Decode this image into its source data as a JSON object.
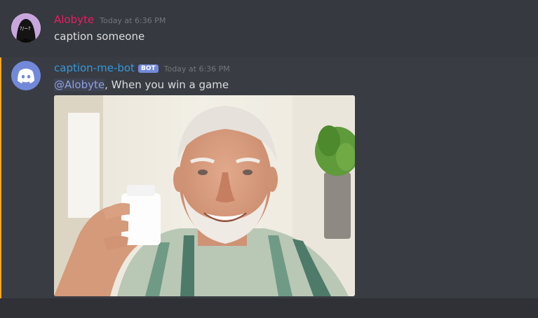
{
  "messages": [
    {
      "author": "Alobyte",
      "author_color": "#e91e63",
      "timestamp": "Today at 6:36 PM",
      "text": "caption someone",
      "avatar_icon": "dark-figure-avatar"
    },
    {
      "author": "caption-me-bot",
      "author_color": "#3498db",
      "bot_tag": "BOT",
      "timestamp": "Today at 6:36 PM",
      "mention": "@Alobyte",
      "text": ", When you win a game",
      "avatar_icon": "discord-logo-icon",
      "attachment": {
        "description": "photo-of-smiling-man-holding-pill-bottle"
      }
    }
  ],
  "colors": {
    "background": "#36393f",
    "highlight": "#393c43",
    "mention_bar": "#faa61a",
    "bot_tag": "#7289da",
    "timestamp": "#72767d",
    "text": "#dcddde"
  }
}
